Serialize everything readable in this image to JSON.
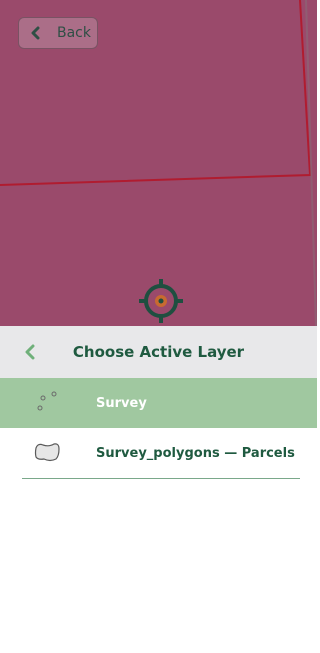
{
  "map": {
    "background_color": "#9a4a6b",
    "boundary_color": "#b01c30"
  },
  "back_button": {
    "label": "Back",
    "icon": "chevron-left-icon"
  },
  "crosshair": {
    "icon": "crosshair-icon"
  },
  "layer_panel": {
    "title": "Choose Active Layer",
    "back_icon": "chevron-left-icon",
    "layers": [
      {
        "label": "Survey",
        "icon": "point-layer-icon",
        "selected": true
      },
      {
        "label": "Survey_polygons — Parcels",
        "icon": "polygon-layer-icon",
        "selected": false
      }
    ],
    "selected_color": "#a0c8a0",
    "accent_color": "#1f5a40"
  }
}
